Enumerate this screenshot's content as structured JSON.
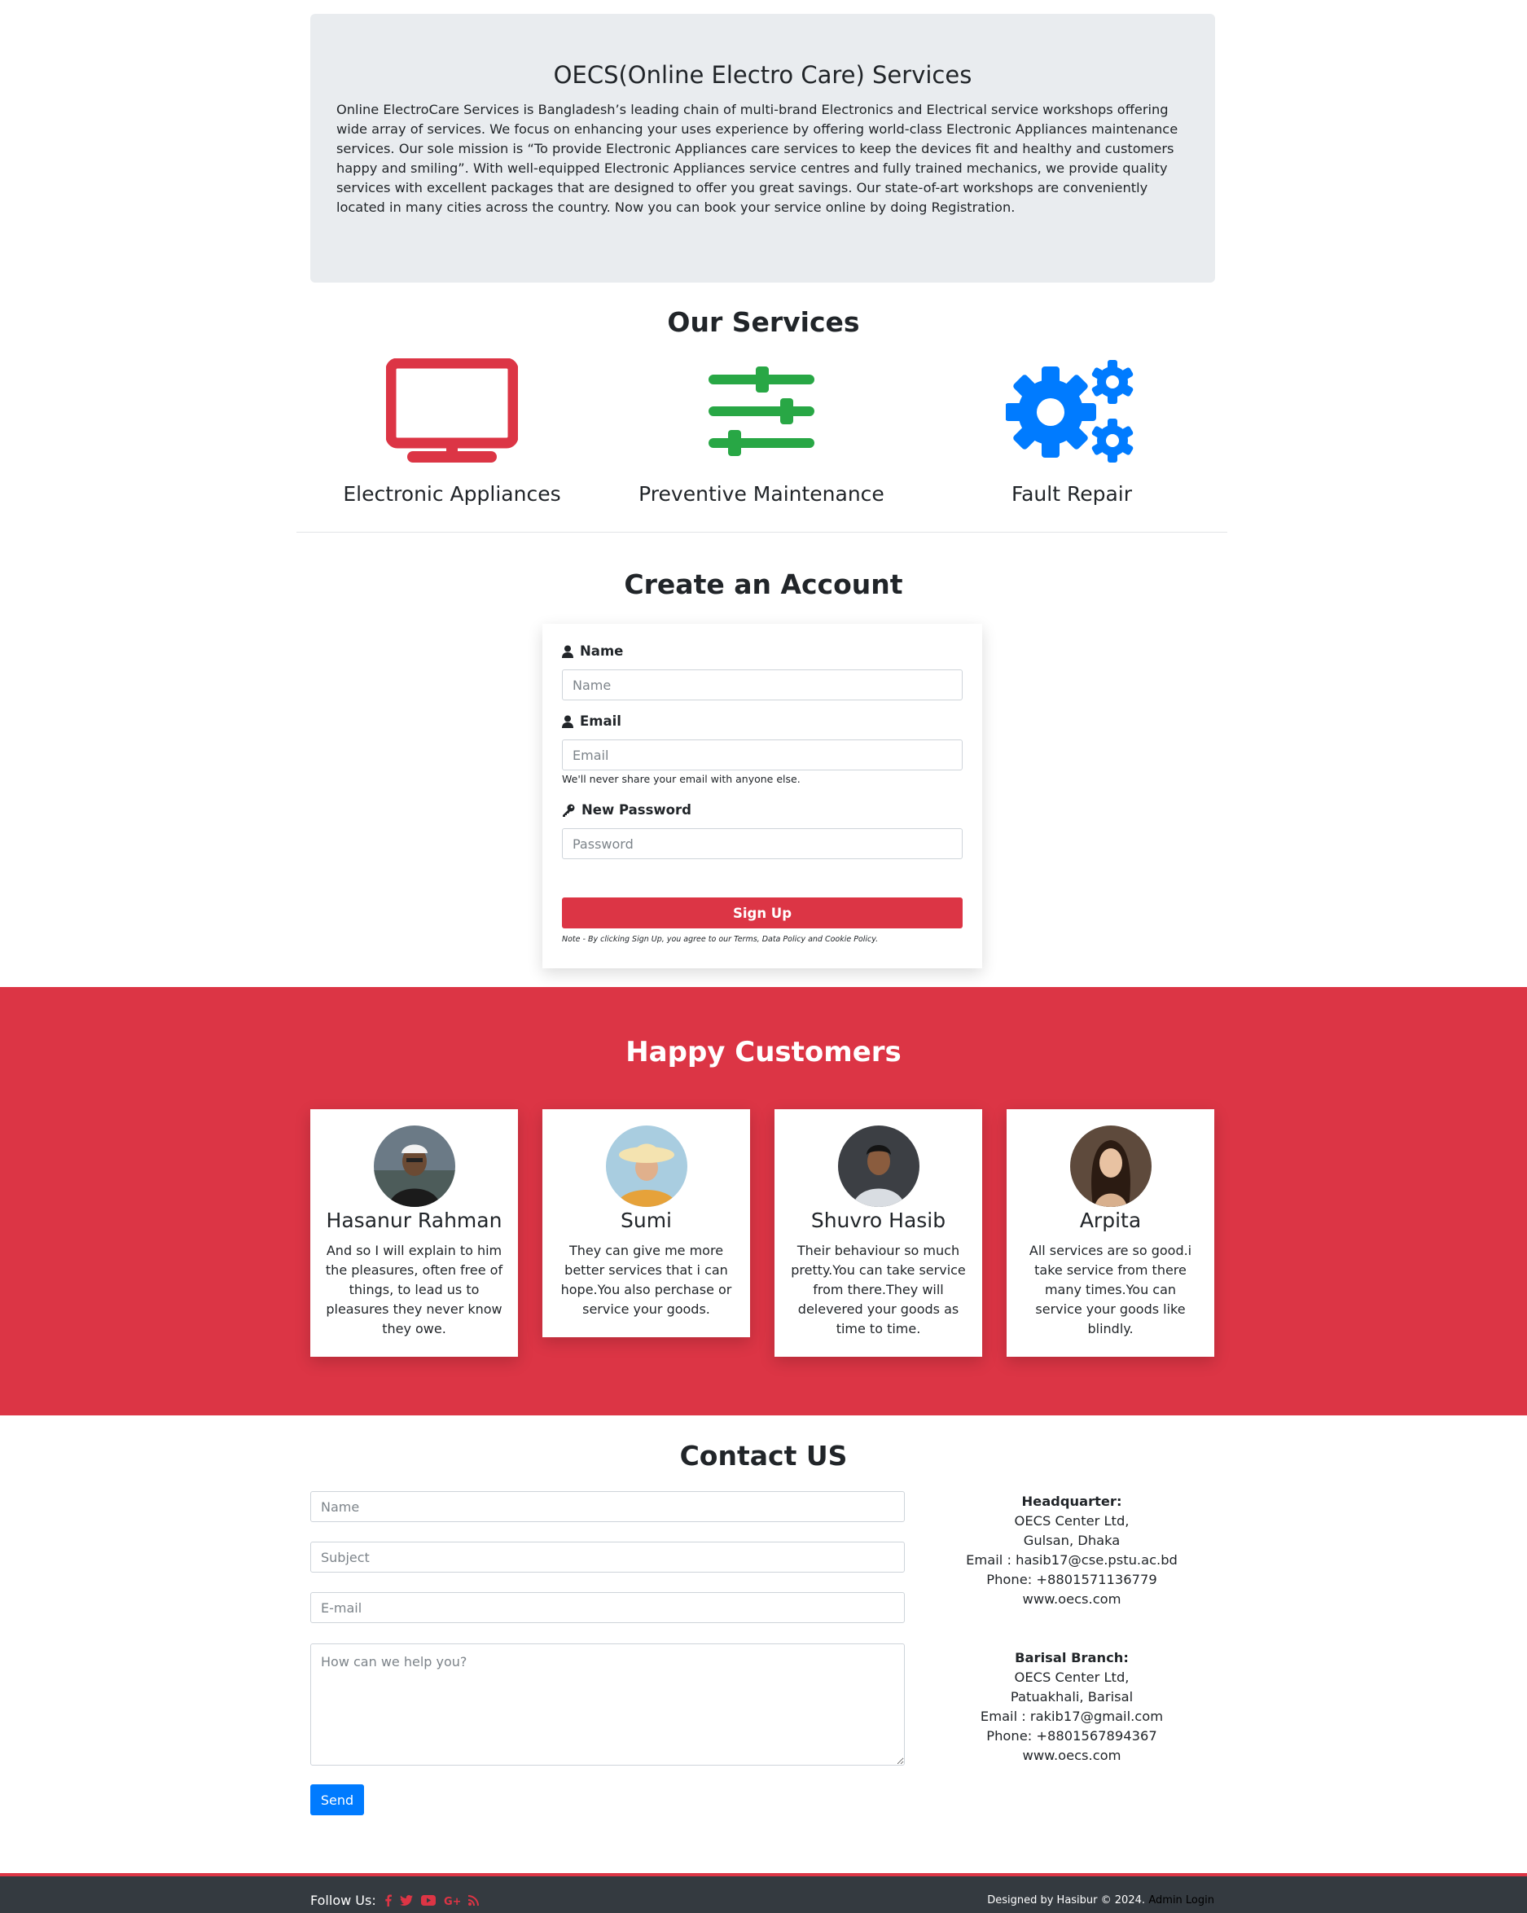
{
  "hero": {
    "title": "OECS(Online Electro Care) Services",
    "text": "Online ElectroCare Services is Bangladesh’s leading chain of multi-brand Electronics and Electrical service workshops offering wide array of services. We focus on enhancing your uses experience by offering world-class Electronic Appliances maintenance services. Our sole mission is “To provide Electronic Appliances care services to keep the devices fit and healthy and customers happy and smiling”. With well-equipped Electronic Appliances service centres and fully trained mechanics, we provide quality services with excellent packages that are designed to offer you great savings. Our state-of-art workshops are conveniently located in many cities across the country. Now you can book your service online by doing Registration."
  },
  "services": {
    "title": "Our Services",
    "items": [
      {
        "label": "Electronic Appliances",
        "icon": "tv-icon",
        "color": "#dc3545"
      },
      {
        "label": "Preventive Maintenance",
        "icon": "sliders-icon",
        "color": "#28a745"
      },
      {
        "label": "Fault Repair",
        "icon": "gears-icon",
        "color": "#007bff"
      }
    ]
  },
  "account": {
    "title": "Create an Account",
    "name_label": "Name",
    "name_placeholder": "Name",
    "email_label": "Email",
    "email_placeholder": "Email",
    "email_help": "We'll never share your email with anyone else.",
    "password_label": "New Password",
    "password_placeholder": "Password",
    "signup_label": "Sign Up",
    "note": "Note - By clicking Sign Up, you agree to our Terms, Data Policy and Cookie Policy."
  },
  "customers": {
    "title": "Happy Customers",
    "items": [
      {
        "name": "Hasanur Rahman",
        "text": "And so I will explain to him the pleasures, often free of things, to lead us to pleasures they never know they owe."
      },
      {
        "name": "Sumi",
        "text": "They can give me more better services that i can hope.You also perchase or service your goods."
      },
      {
        "name": "Shuvro Hasib",
        "text": "Their behaviour so much pretty.You can take service from there.They will delevered your goods as time to time."
      },
      {
        "name": "Arpita",
        "text": "All services are so good.i take service from there many times.You can service your goods like blindly."
      }
    ]
  },
  "contact": {
    "title": "Contact US",
    "name_placeholder": "Name",
    "subject_placeholder": "Subject",
    "email_placeholder": "E-mail",
    "message_placeholder": "How can we help you?",
    "send_label": "Send",
    "hq": {
      "heading": "Headquarter:",
      "lines": [
        "OECS Center Ltd,",
        "Gulsan, Dhaka",
        "Email : hasib17@cse.pstu.ac.bd",
        "Phone: +8801571136779",
        "www.oecs.com"
      ]
    },
    "branch": {
      "heading": "Barisal Branch:",
      "lines": [
        "OECS Center Ltd,",
        "Patuakhali, Barisal",
        "Email : rakib17@gmail.com",
        "Phone: +8801567894367",
        "www.oecs.com"
      ]
    }
  },
  "footer": {
    "follow_label": "Follow Us:",
    "social": [
      "f",
      "t",
      "▶",
      "G+",
      "rss"
    ],
    "designed": "Designed by Hasibur © 2024.",
    "admin": "Admin Login"
  }
}
